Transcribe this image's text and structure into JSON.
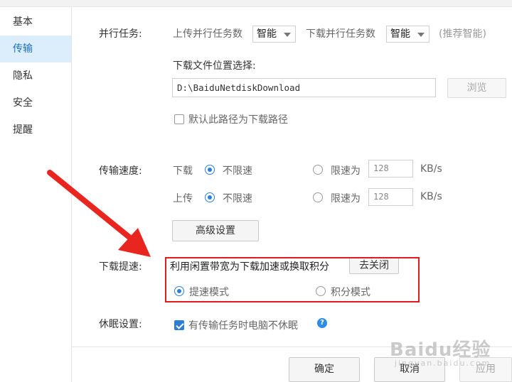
{
  "sidebar": {
    "items": [
      {
        "label": "基本"
      },
      {
        "label": "传输"
      },
      {
        "label": "隐私"
      },
      {
        "label": "安全"
      },
      {
        "label": "提醒"
      }
    ],
    "active_index": 1
  },
  "parallel": {
    "label": "并行任务:",
    "upload_label": "上传并行任务数",
    "upload_value": "智能",
    "download_label": "下载并行任务数",
    "download_value": "智能",
    "hint": "(推荐智能)"
  },
  "download_location": {
    "label": "下载文件位置选择:",
    "path": "D:\\BaiduNetdiskDownload",
    "browse_label": "浏览",
    "default_checkbox_label": "默认此路径为下载路径",
    "default_checked": false
  },
  "speed": {
    "label": "传输速度:",
    "download_label": "下载",
    "upload_label": "上传",
    "unlimited_label": "不限速",
    "limit_label": "限速为",
    "download_limit": "128",
    "upload_limit": "128",
    "unit": "KB/s",
    "advanced_label": "高级设置"
  },
  "boost": {
    "label": "下载提速:",
    "description": "利用闲置带宽为下载加速或换取积分",
    "close_label": "去关闭",
    "boost_mode_label": "提速模式",
    "points_mode_label": "积分模式",
    "selected": "boost"
  },
  "sleep": {
    "label": "休眠设置:",
    "checkbox_label": "有传输任务时电脑不休眠",
    "checked": true
  },
  "footer": {
    "ok_label": "确定",
    "cancel_label": "取消",
    "apply_label": "应用"
  },
  "watermark": {
    "text": "Baidu经验",
    "sub": "jingyan.baidu.com"
  },
  "colors": {
    "accent": "#2d7fd6",
    "highlight": "#e21c1c",
    "arrow": "#e8261f"
  }
}
